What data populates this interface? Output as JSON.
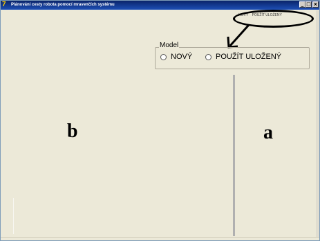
{
  "window": {
    "title": "Plánování cesty robota pomocí mravenčích systému"
  },
  "title_controls": {
    "minimize": "_",
    "maximize": "□",
    "close": "x"
  },
  "mini_options": {
    "new_label": "NOVÝ",
    "saved_label": "POUŽÍT ULOŽENÝ"
  },
  "model_group": {
    "legend": "Model",
    "options": [
      {
        "label": "NOVÝ",
        "selected": false
      },
      {
        "label": "POUŽÍT ULOŽENÝ",
        "selected": false
      }
    ]
  },
  "annotations": {
    "left_panel": "b",
    "right_panel": "a"
  },
  "colors": {
    "titlebar": "#0a246a",
    "window_bg": "#ece9d8",
    "ellipse": "#000000"
  },
  "icons": [
    "app-icon",
    "arrow-icon"
  ]
}
